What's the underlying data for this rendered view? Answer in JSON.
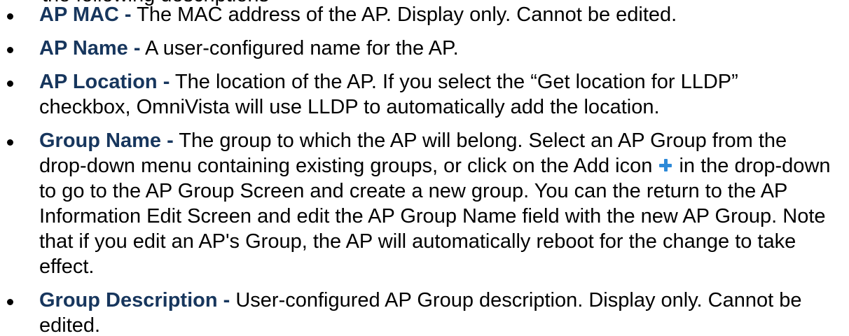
{
  "cut_line": "the following descriptions",
  "items": [
    {
      "term": "AP MAC -",
      "text": "The MAC address of the AP. Display only. Cannot be edited."
    },
    {
      "term": "AP Name -",
      "text": "A user-configured name for the AP."
    },
    {
      "term": "AP Location -",
      "text": "The location of the AP. If you select the “Get location for LLDP” checkbox, OmniVista will use LLDP to automatically add the location."
    },
    {
      "term": "Group Name -",
      "text_before_icon": "The group to which the AP will belong. Select an AP Group from the drop-down menu containing existing groups, or click on the Add icon",
      "icon": "add-icon",
      "text_after_icon": "in the drop-down to go to the AP Group Screen and create a new group. You can the return to the AP Information Edit Screen and edit the AP Group Name field with the new AP Group. Note that if you edit an AP's Group, the AP will automatically reboot for the change to take effect."
    },
    {
      "term": "Group Description -",
      "text": "User-configured AP Group description. Display only. Cannot be edited."
    }
  ]
}
